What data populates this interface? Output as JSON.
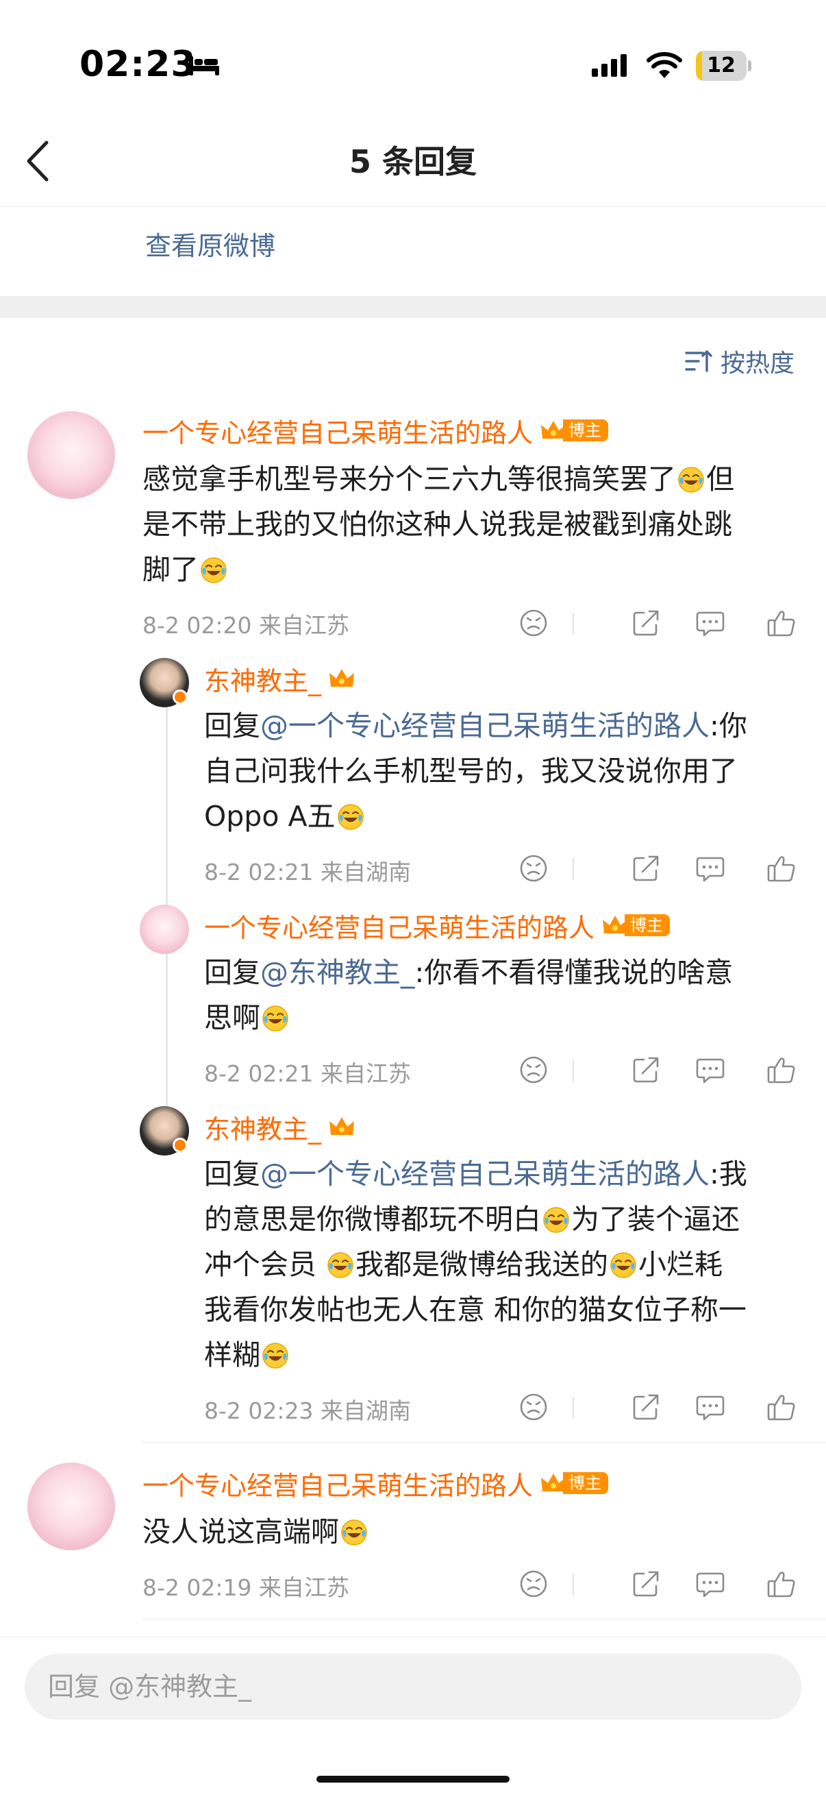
{
  "status_bar": {
    "time": "02:23",
    "battery_level": "12",
    "battery_fraction": 0.12,
    "icons": [
      "bed-icon",
      "cellular-signal-icon",
      "wifi-icon",
      "battery-icon"
    ]
  },
  "header": {
    "title": "5 条回复",
    "back_icon": "chevron-left-icon"
  },
  "view_original": "查看原微博",
  "sort": {
    "label": "按热度",
    "icon": "sort-lines-icon"
  },
  "badges": {
    "bozhu": "博主"
  },
  "colors": {
    "username": "#ff6a00",
    "mention": "#4a6a93",
    "meta": "#9a9a9a",
    "badge": "#ff9100",
    "battery_fill": "#f5c518"
  },
  "comments": [
    {
      "user": "一个专心经营自己呆萌生活的路人",
      "text_parts": [
        "感觉拿手机型号来分个三六九等很搞笑罢了",
        "但",
        "是不带上我的又怕你这种人说我是被戳到痛处跳",
        "脚了"
      ],
      "meta": "8-2 02:20  来自江苏"
    },
    {
      "user": "东神教主_",
      "reply_prefix": "回复",
      "mention": "@一个专心经营自己呆萌生活的路人",
      "text_parts": [
        ":你",
        "自己问我什么手机型号的，我又没说你用了",
        "Oppo A五"
      ],
      "meta": "8-2 02:21  来自湖南"
    },
    {
      "user": "一个专心经营自己呆萌生活的路人",
      "reply_prefix": "回复",
      "mention": "@东神教主_",
      "text_parts": [
        ":你看不看得懂我说的啥意",
        "思啊"
      ],
      "meta": "8-2 02:21  来自江苏"
    },
    {
      "user": "东神教主_",
      "reply_prefix": "回复",
      "mention": "@一个专心经营自己呆萌生活的路人",
      "text_parts": [
        ":我",
        "的意思是你微博都玩不明白",
        "为了装个逼还",
        "冲个会员 ",
        "我都是微博给我送的",
        "小烂耗",
        "我看你发帖也无人在意 和你的猫女位子称一",
        "样糊"
      ],
      "meta": "8-2 02:23  来自湖南"
    },
    {
      "user": "一个专心经营自己呆萌生活的路人",
      "text_parts": [
        "没人说这高端啊"
      ],
      "meta": "8-2 02:19  来自江苏"
    }
  ],
  "action_icons": [
    "dislike-face-icon",
    "share-icon",
    "comment-icon",
    "like-thumb-icon"
  ],
  "reply_input": {
    "placeholder": "回复 @东神教主_"
  }
}
